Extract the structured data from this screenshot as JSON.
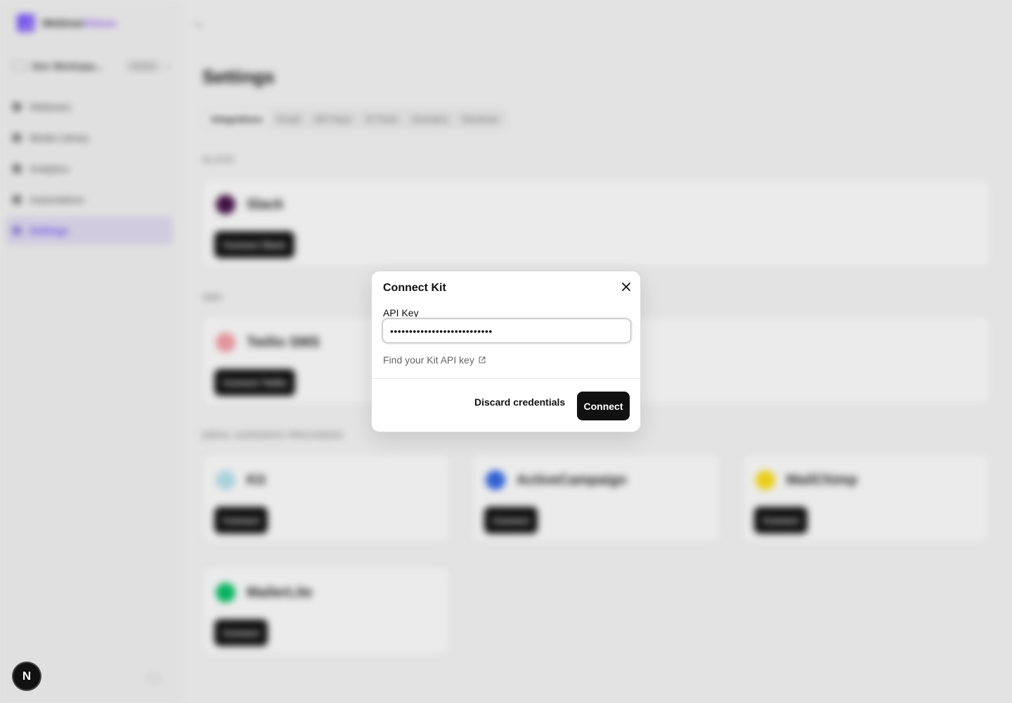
{
  "app": {
    "brand_first": "Webinar",
    "brand_second": "Kitson",
    "workspace_name": "Dev Workspa...",
    "workspace_badge": "Owner",
    "nav": [
      {
        "label": "Webinars"
      },
      {
        "label": "Media Library"
      },
      {
        "label": "Analytics"
      },
      {
        "label": "Automations"
      },
      {
        "label": "Settings"
      }
    ],
    "page_title": "Settings",
    "tabs": [
      "Integrations",
      "Email",
      "API Keys",
      "AI Tools",
      "Domains",
      "Revenue"
    ],
    "sections": {
      "slack_label": "SLACK",
      "sms_label": "SMS",
      "email_label": "EMAIL AUDIENCE PROVIDERS"
    },
    "cards": [
      {
        "name": "Slack",
        "button": "Connect Slack",
        "color": "#4a154b"
      },
      {
        "name": "Twilio SMS",
        "button": "Connect Twilio",
        "color": "#f7a1ab"
      },
      {
        "name": "Kit",
        "button": "Connect",
        "color": "#b9e4ef"
      },
      {
        "name": "ActiveCampaign",
        "button": "Connect",
        "color": "#356ae6"
      },
      {
        "name": "MailChimp",
        "button": "Connect",
        "color": "#ffe01b"
      },
      {
        "name": "MailerLite",
        "button": "Connect",
        "color": "#09c269"
      }
    ],
    "next_badge": "N"
  },
  "dialog": {
    "title": "Connect Kit",
    "api_key_label": "API Key",
    "api_key_value": "•••••••••••••••••••••••••••",
    "help_link": "Find your Kit API key",
    "discard_label": "Discard credentials",
    "connect_label": "Connect"
  },
  "icons": {
    "close": "close-icon",
    "external": "external-link-icon"
  }
}
